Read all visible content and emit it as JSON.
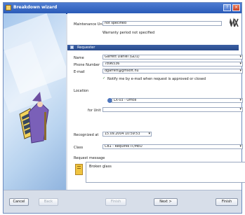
{
  "window": {
    "title": "Breakdown wizard"
  },
  "header": {
    "maintenance_unit_label": "Maintenance Unit",
    "maintenance_unit_value": "not specified",
    "warranty_note": "Warranty period not specified"
  },
  "section": {
    "title": "Requester"
  },
  "requester": {
    "name_label": "Name",
    "name_value": "Garrett Daniel (GD1)",
    "phone_label": "Phone Number",
    "phone_value": "7896536",
    "email_label": "E-mail",
    "email_value": "dgarrett@gmsoft.hu",
    "notify_text": "Notify me by e-mail when request is approved or closed"
  },
  "location": {
    "label": "Location",
    "value": "LX-03 - Office",
    "for_unit_label": "for Unit",
    "for_unit_value": ""
  },
  "recognized": {
    "label": "Recognized at",
    "value": "15.09.2004 10:59:53"
  },
  "class": {
    "label": "Class",
    "value": "CB1 - Requires IT/MEO"
  },
  "message": {
    "label": "Request message",
    "text": "Broken glass"
  },
  "footer": {
    "cancel": "Cancel",
    "back": "Back",
    "finish": "Finish",
    "next": "Next >",
    "help": "Finish"
  },
  "icons": {
    "title": "wizard-icon",
    "brand": "mx-icon",
    "section": "doc-icon",
    "location": "location-icon",
    "note": "note-icon"
  },
  "colors": {
    "title_bar": "#2a5bb8",
    "section_bar": "#294b8b",
    "window_bg": "#d7dee9"
  }
}
